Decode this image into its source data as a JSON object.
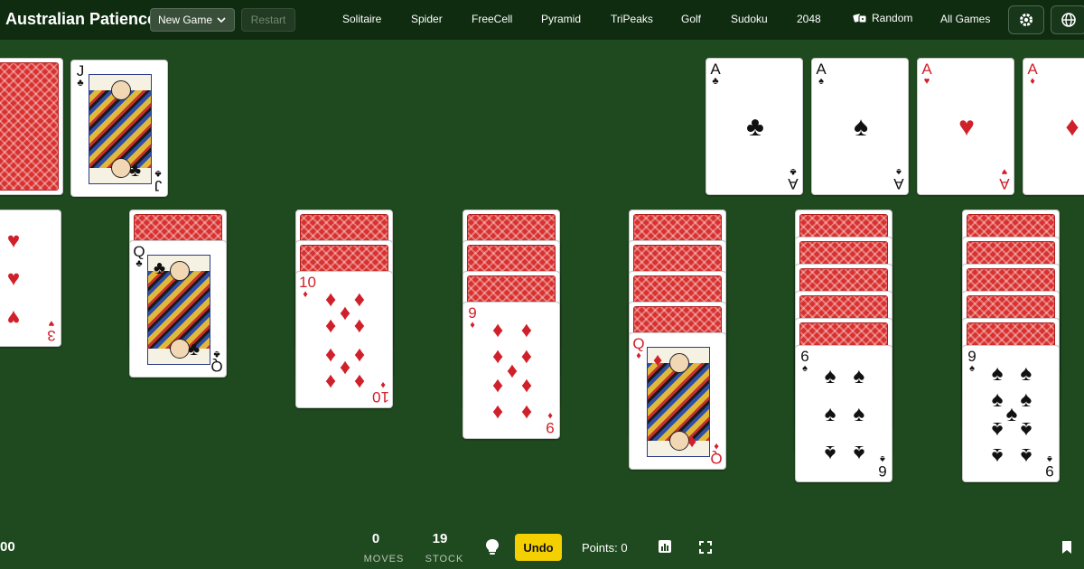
{
  "header": {
    "title": "Australian Patience",
    "new_game": "New Game",
    "restart": "Restart",
    "nav": [
      "Solitaire",
      "Spider",
      "FreeCell",
      "Pyramid",
      "TriPeaks",
      "Golf",
      "Sudoku",
      "2048",
      "Random",
      "All Games"
    ]
  },
  "colors": {
    "felt": "#1f4a1f",
    "topbar": "#0f2c10",
    "undo": "#f4d000",
    "card_red": "#d0202a",
    "card_back": "#d8312f"
  },
  "waste": {
    "rank": "J",
    "suit": "♣",
    "color": "black"
  },
  "foundations": [
    {
      "rank": "A",
      "suit": "♣",
      "color": "black"
    },
    {
      "rank": "A",
      "suit": "♠",
      "color": "black"
    },
    {
      "rank": "A",
      "suit": "♥",
      "color": "red"
    },
    {
      "rank": "A",
      "suit": "♦",
      "color": "red"
    }
  ],
  "tableau": [
    {
      "face_down": 0,
      "top": {
        "rank": "3",
        "suit": "♥",
        "color": "red"
      }
    },
    {
      "face_down": 1,
      "top": {
        "rank": "Q",
        "suit": "♣",
        "color": "black"
      }
    },
    {
      "face_down": 2,
      "top": {
        "rank": "10",
        "suit": "♦",
        "color": "red"
      }
    },
    {
      "face_down": 3,
      "top": {
        "rank": "9",
        "suit": "♦",
        "color": "red"
      }
    },
    {
      "face_down": 4,
      "top": {
        "rank": "Q",
        "suit": "♦",
        "color": "red"
      }
    },
    {
      "face_down": 5,
      "top": {
        "rank": "6",
        "suit": "♠",
        "color": "black"
      }
    },
    {
      "face_down": 5,
      "top": {
        "rank": "9",
        "suit": "♠",
        "color": "black"
      }
    }
  ],
  "footer": {
    "left_value": "00",
    "moves_value": "0",
    "moves_label": "MOVES",
    "stock_value": "19",
    "stock_label": "STOCK",
    "undo": "Undo",
    "points": "Points: 0"
  }
}
